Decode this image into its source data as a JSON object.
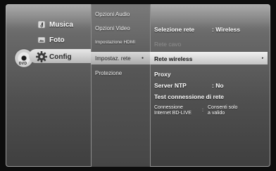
{
  "brand": {
    "disc_label": "DVD"
  },
  "main_menu": [
    {
      "label": "Musica",
      "icon": "music-icon"
    },
    {
      "label": "Foto",
      "icon": "photo-icon"
    },
    {
      "label": "Config",
      "icon": "gear-icon",
      "selected": true
    }
  ],
  "submenu": [
    {
      "label": "Opzioni Audio"
    },
    {
      "label": "Opzioni Video"
    },
    {
      "label": "Impostazione HDMI"
    },
    {
      "label": "Impostaz. rete",
      "selected": true
    },
    {
      "label": "Protezione"
    }
  ],
  "settings": {
    "selezione_rete": {
      "label": "Selezione rete",
      "value": ": Wireless"
    },
    "rete_cavo": {
      "label": "Rete cavo"
    },
    "rete_wireless": {
      "label": "Rete wireless",
      "arrow": "▸"
    },
    "proxy": {
      "label": "Proxy"
    },
    "server_ntp": {
      "label": "Server NTP",
      "value": ": No"
    },
    "test_connessione": {
      "label": "Test connessione di rete"
    },
    "connessione_bd_live": {
      "label_line1": "Connessione",
      "label_line2": "Internet BD-LIVE",
      "value_colon": ":",
      "value_line1": "Consenti solo",
      "value_line2": "a valido"
    }
  },
  "colors": {
    "background": "#0d0d0d",
    "highlight": "#e8e8e8"
  }
}
